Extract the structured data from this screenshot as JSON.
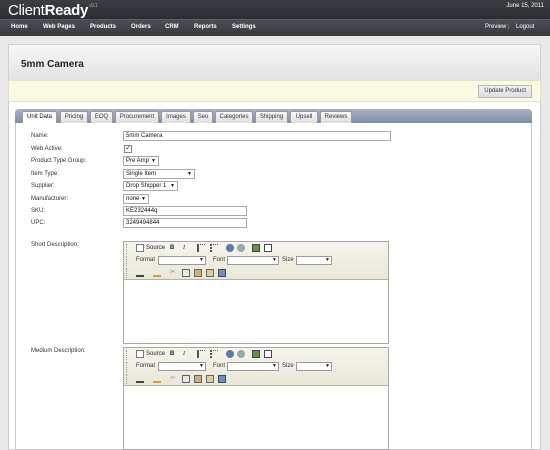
{
  "app": {
    "logo_main": "Client",
    "logo_bold": "Ready",
    "version": "v3.1",
    "date": "June 15, 2011"
  },
  "nav": {
    "items": [
      "Home",
      "Web Pages",
      "Products",
      "Orders",
      "CRM",
      "Reports",
      "Settings"
    ],
    "preview": "Preview",
    "separator": "|",
    "logout": "Logout"
  },
  "page": {
    "title": "5mm Camera",
    "update_button": "Update Product"
  },
  "tabs": [
    "Unit Data",
    "Pricing",
    "EOQ",
    "Procurement",
    "Images",
    "Seo",
    "Categories",
    "Shipping",
    "Upsell",
    "Reviews"
  ],
  "form": {
    "name_label": "Name:",
    "name_value": "5mm Camera",
    "active_label": "Web Active:",
    "active_checked": "✓",
    "ptg_label": "Product Type Group:",
    "ptg_value": "Pre Amp",
    "item_type_label": "Item Type:",
    "item_type_value": "Single Item",
    "supplier_label": "Supplier:",
    "supplier_value": "Drop Shipper 1",
    "manufacturer_label": "Manufacturer:",
    "manufacturer_value": "none",
    "sku_label": "SKU:",
    "sku_value": "KE232444q",
    "upc_label": "UPC:",
    "upc_value": "3249494844",
    "short_desc_label": "Short Description:",
    "medium_desc_label": "Medium Description:"
  },
  "editor": {
    "source_label": "Source",
    "bold": "B",
    "italic": "I",
    "format_label": "Format",
    "font_label": "Font",
    "size_label": "Size"
  }
}
